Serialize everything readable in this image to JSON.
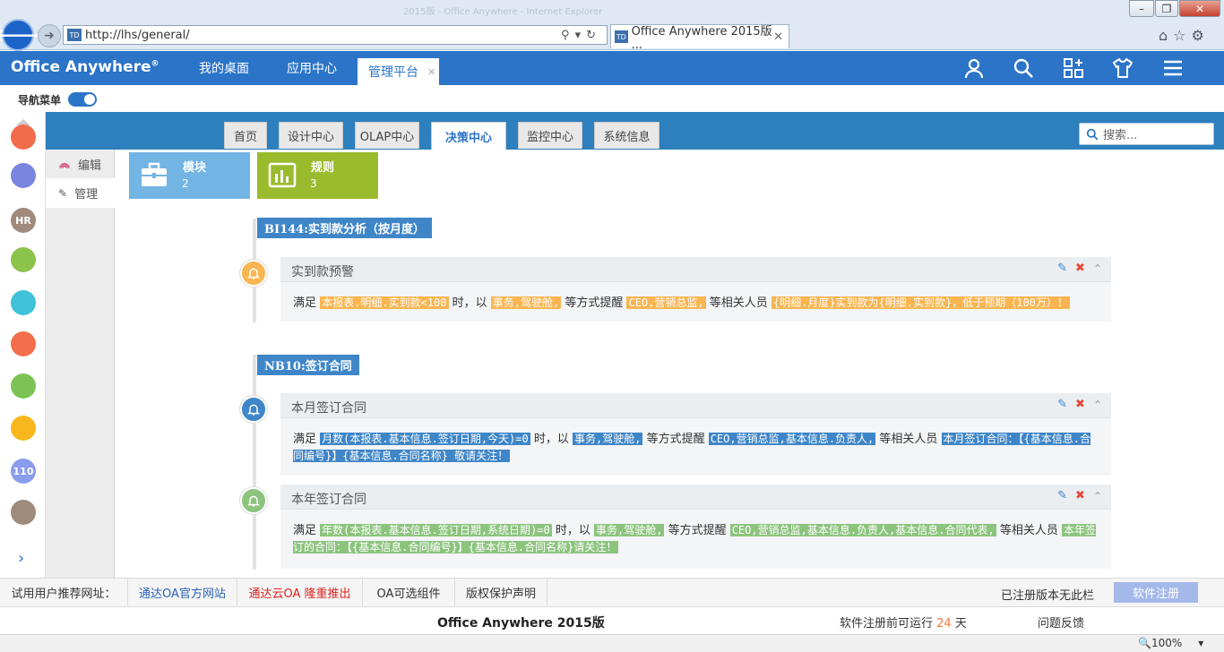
{
  "browser": {
    "window_title": "2015版 - Office Anywhere - Internet Explorer",
    "address": "http://lhs/general/",
    "tab_title": "Office Anywhere 2015版 ...",
    "favicon_text": "TD",
    "zoom": "100%"
  },
  "app": {
    "logo": "Office Anywhere",
    "logo_mark": "®",
    "nav_tabs": [
      "我的桌面",
      "应用中心",
      "管理平台"
    ],
    "nav_toggle_label": "导航菜单"
  },
  "submenu": {
    "tabs": [
      "首页",
      "设计中心",
      "OLAP中心",
      "决策中心",
      "监控中心",
      "系统信息"
    ],
    "active": "决策中心",
    "search_placeholder": "搜索..."
  },
  "left_menu": [
    {
      "label": "编辑",
      "icon": "dashboard-icon"
    },
    {
      "label": "管理",
      "icon": "edit-icon"
    }
  ],
  "sidebar_icons": [
    {
      "name": "calendar-icon",
      "color": "#f26b4b",
      "text": ""
    },
    {
      "name": "notes-icon",
      "color": "#7a85e0",
      "text": ""
    },
    {
      "name": "hr-icon",
      "color": "#a08a7c",
      "text": "HR"
    },
    {
      "name": "briefcase-icon",
      "color": "#8cc34b",
      "text": ""
    },
    {
      "name": "inbox-icon",
      "color": "#3fc1d8",
      "text": ""
    },
    {
      "name": "hand-icon",
      "color": "#f36f4b",
      "text": ""
    },
    {
      "name": "bar-chart-icon",
      "color": "#7cc355",
      "text": ""
    },
    {
      "name": "ticket-icon",
      "color": "#f7b71d",
      "text": ""
    },
    {
      "name": "cloud-icon",
      "color": "#8a9cee",
      "text": "110"
    },
    {
      "name": "attachment-icon",
      "color": "#a08a7c",
      "text": ""
    }
  ],
  "cards": [
    {
      "title": "模块",
      "count": "2",
      "color": "#72b4e4"
    },
    {
      "title": "规则",
      "count": "3",
      "color": "#9bbb2e"
    }
  ],
  "sections": [
    {
      "header": "BI144:实到款分析（按月度）",
      "rules": [
        {
          "title": "实到款预警",
          "bell_color": "#f9b552",
          "segments": [
            {
              "t": "满足 ",
              "h": ""
            },
            {
              "t": "本报表.明细.实到款<100",
              "h": "o"
            },
            {
              "t": " 时，以 ",
              "h": ""
            },
            {
              "t": "事务,驾驶舱,",
              "h": "o"
            },
            {
              "t": " 等方式提醒 ",
              "h": ""
            },
            {
              "t": "CEO,营销总监,",
              "h": "o"
            },
            {
              "t": " 等相关人员 ",
              "h": ""
            },
            {
              "t": "{明细.月度}实到款为{明细.实到款}，低于预期（100万）！",
              "h": "o"
            }
          ]
        }
      ]
    },
    {
      "header": "NB10:签订合同",
      "rules": [
        {
          "title": "本月签订合同",
          "bell_color": "#3f86c8",
          "segments": [
            {
              "t": "满足 ",
              "h": ""
            },
            {
              "t": "月数(本报表.基本信息.签订日期,今天)=0",
              "h": "b"
            },
            {
              "t": " 时，以 ",
              "h": ""
            },
            {
              "t": "事务,驾驶舱,",
              "h": "b"
            },
            {
              "t": " 等方式提醒 ",
              "h": ""
            },
            {
              "t": "CEO,营销总监,基本信息.负责人,",
              "h": "b"
            },
            {
              "t": " 等相关人员 ",
              "h": ""
            },
            {
              "t": "本月签订合同：【{基本信息.合同编号}】{基本信息.合同名称} 敬请关注！",
              "h": "b"
            }
          ]
        },
        {
          "title": "本年签订合同",
          "bell_color": "#8cc47e",
          "segments": [
            {
              "t": "满足 ",
              "h": ""
            },
            {
              "t": "年数(本报表.基本信息.签订日期,系统日期)=0",
              "h": "g"
            },
            {
              "t": " 时，以 ",
              "h": ""
            },
            {
              "t": "事务,驾驶舱,",
              "h": "g"
            },
            {
              "t": " 等方式提醒 ",
              "h": ""
            },
            {
              "t": "CEO,营销总监,基本信息.负责人,基本信息.合同代表,",
              "h": "g"
            },
            {
              "t": " 等相关人员 ",
              "h": ""
            },
            {
              "t": "本年签订的合同：【{基本信息.合同编号}】{基本信息.合同名称}请关注！",
              "h": "g"
            }
          ]
        }
      ]
    }
  ],
  "footer": {
    "links_label": "试用用户推荐网址：",
    "links": [
      "通达OA官方网站",
      "通达云OA 隆重推出",
      "OA可选组件",
      "版权保护声明"
    ],
    "registered_note": "已注册版本无此栏",
    "register_button": "软件注册",
    "product": "Office Anywhere 2015版",
    "trial_prefix": "软件注册前可运行",
    "trial_days": "24",
    "trial_suffix": "天",
    "feedback": "问题反馈"
  }
}
